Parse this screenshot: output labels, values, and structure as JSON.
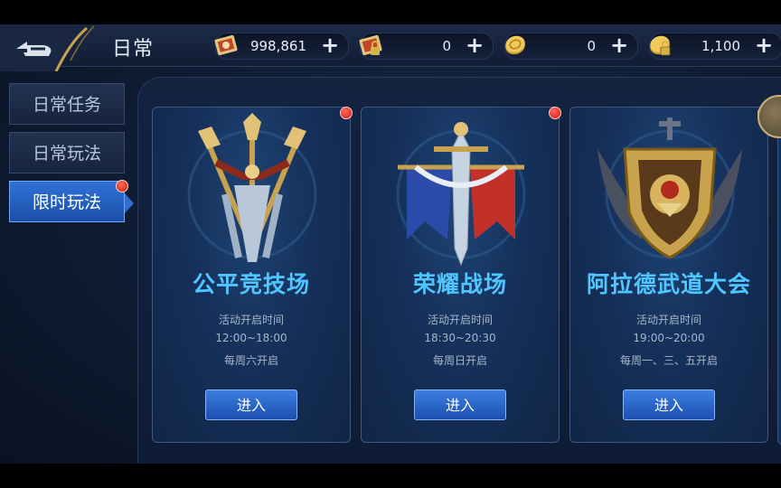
{
  "header": {
    "title": "日常"
  },
  "resources": [
    {
      "icon": "scroll-voucher-icon",
      "value": "998,861"
    },
    {
      "icon": "locked-scroll-icon",
      "value": "0"
    },
    {
      "icon": "gold-coin-icon",
      "value": "0"
    },
    {
      "icon": "locked-coin-icon",
      "value": "1,100"
    }
  ],
  "tabs": [
    {
      "label": "日常任务",
      "active": false,
      "badge": false
    },
    {
      "label": "日常玩法",
      "active": false,
      "badge": false
    },
    {
      "label": "限时玩法",
      "active": true,
      "badge": true
    }
  ],
  "cards": [
    {
      "name": "公平竞技场",
      "schedule_label": "活动开启时间",
      "time": "12:00~18:00",
      "days": "每周六开启",
      "button": "进入",
      "emblem": "tridents-emblem-icon"
    },
    {
      "name": "荣耀战场",
      "schedule_label": "活动开启时间",
      "time": "18:30~20:30",
      "days": "每周日开启",
      "button": "进入",
      "emblem": "banner-sword-emblem-icon"
    },
    {
      "name": "阿拉德武道大会",
      "schedule_label": "活动开启时间",
      "time": "19:00~20:00",
      "days": "每周一、三、五开启",
      "button": "进入",
      "emblem": "shield-emblem-icon"
    }
  ],
  "colors": {
    "accent": "#4fc6ff",
    "button": "#2a64c8",
    "badge": "#e0241a",
    "gold": "#c9a24e"
  }
}
